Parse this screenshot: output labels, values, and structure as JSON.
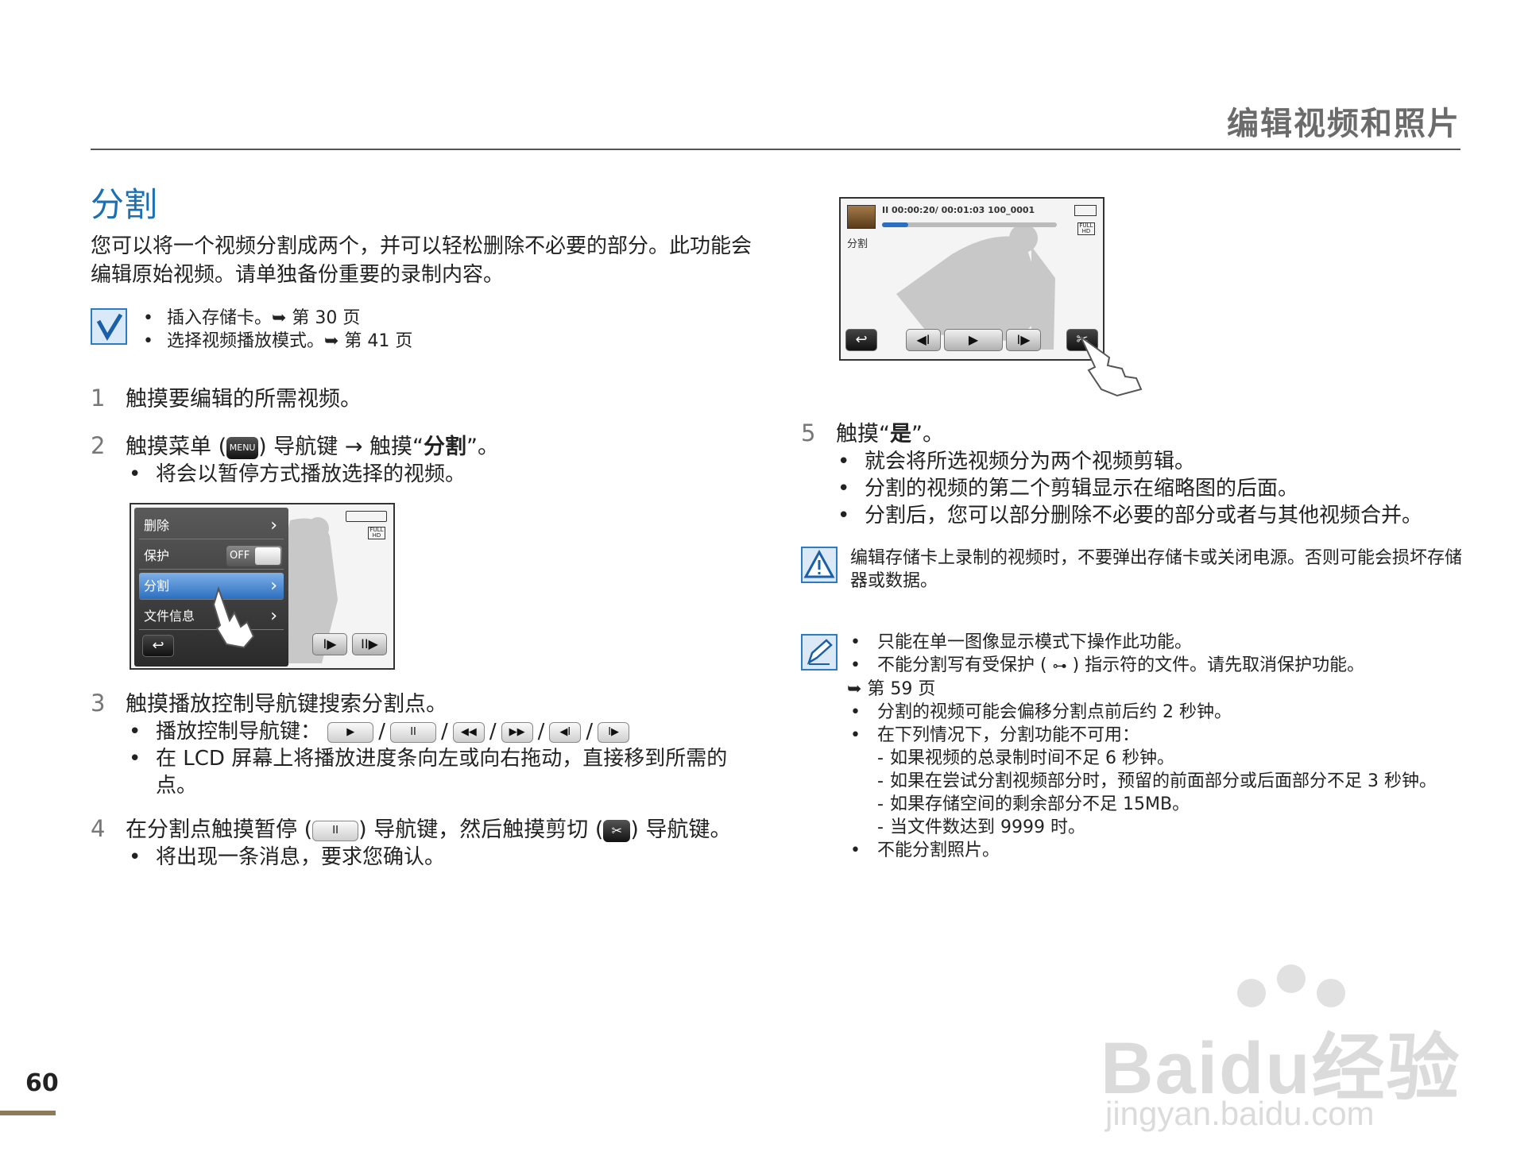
{
  "header": {
    "title": "编辑视频和照片"
  },
  "section_title": "分割",
  "intro": "您可以将一个视频分割成两个，并可以轻松删除不必要的部分。此功能会编辑原始视频。请单独备份重要的录制内容。",
  "prereq": [
    "插入存储卡。➥ 第 30 页",
    "选择视频播放模式。➥ 第 41 页"
  ],
  "steps": {
    "s1": {
      "num": "1",
      "text": "触摸要编辑的所需视频。"
    },
    "s2": {
      "num": "2",
      "text_a": "触摸菜单 (",
      "menu_label": "MENU",
      "text_b": ") 导航键 → 触摸“",
      "bold": "分割",
      "text_c": "”。",
      "sub": [
        "将会以暂停方式播放选择的视频。"
      ]
    },
    "s3": {
      "num": "3",
      "text": "触摸播放控制导航键搜索分割点。",
      "sub1_label": "播放控制导航键：",
      "buttons": [
        "▶",
        "II",
        "◀◀",
        "▶▶",
        "◀I",
        "I▶"
      ],
      "sub2": "在 LCD 屏幕上将播放进度条向左或向右拖动，直接移到所需的点。"
    },
    "s4": {
      "num": "4",
      "text_a": "在分割点触摸暂停 (",
      "pause": "II",
      "text_b": ") 导航键，然后触摸剪切 (",
      "text_c": ") 导航键。",
      "sub": [
        "将出现一条消息，要求您确认。"
      ]
    },
    "s5": {
      "num": "5",
      "text_a": "触摸“",
      "bold": "是",
      "text_b": "”。",
      "sub": [
        "就会将所选视频分为两个视频剪辑。",
        "分割的视频的第二个剪辑显示在缩略图的后面。",
        "分割后，您可以部分删除不必要的部分或者与其他视频合并。"
      ]
    }
  },
  "menu_screen": {
    "items": [
      "删除",
      "保护",
      "分割",
      "文件信息"
    ],
    "toggle": "OFF",
    "back": "↩"
  },
  "play_screen": {
    "status": "II  00:00:20/ 00:01:03  100_0001",
    "label": "分割",
    "progress": 0.15,
    "back": "↩"
  },
  "caution": "编辑存储卡上录制的视频时，不要弹出存储卡或关闭电源。否则可能会损坏存储器或数据。",
  "memo": {
    "b1": "只能在单一图像显示模式下操作此功能。",
    "b2": "不能分割写有受保护 ( ",
    "b2_end": " ) 指示符的文件。请先取消保护功能。",
    "b2_ref": "➥ 第 59 页",
    "b3": "分割的视频可能会偏移分割点前后约 2 秒钟。",
    "b4": "在下列情况下，分割功能不可用：",
    "d1": "如果视频的总录制时间不足 6 秒钟。",
    "d2": "如果在尝试分割视频部分时，预留的前面部分或后面部分不足 3 秒钟。",
    "d3": "如果存储空间的剩余部分不足 15MB。",
    "d4": "当文件数达到 9999 时。",
    "b5": "不能分割照片。"
  },
  "page_number": "60",
  "watermark": {
    "line1": "Baidu经验",
    "line2": "jingyan.baidu.com"
  }
}
